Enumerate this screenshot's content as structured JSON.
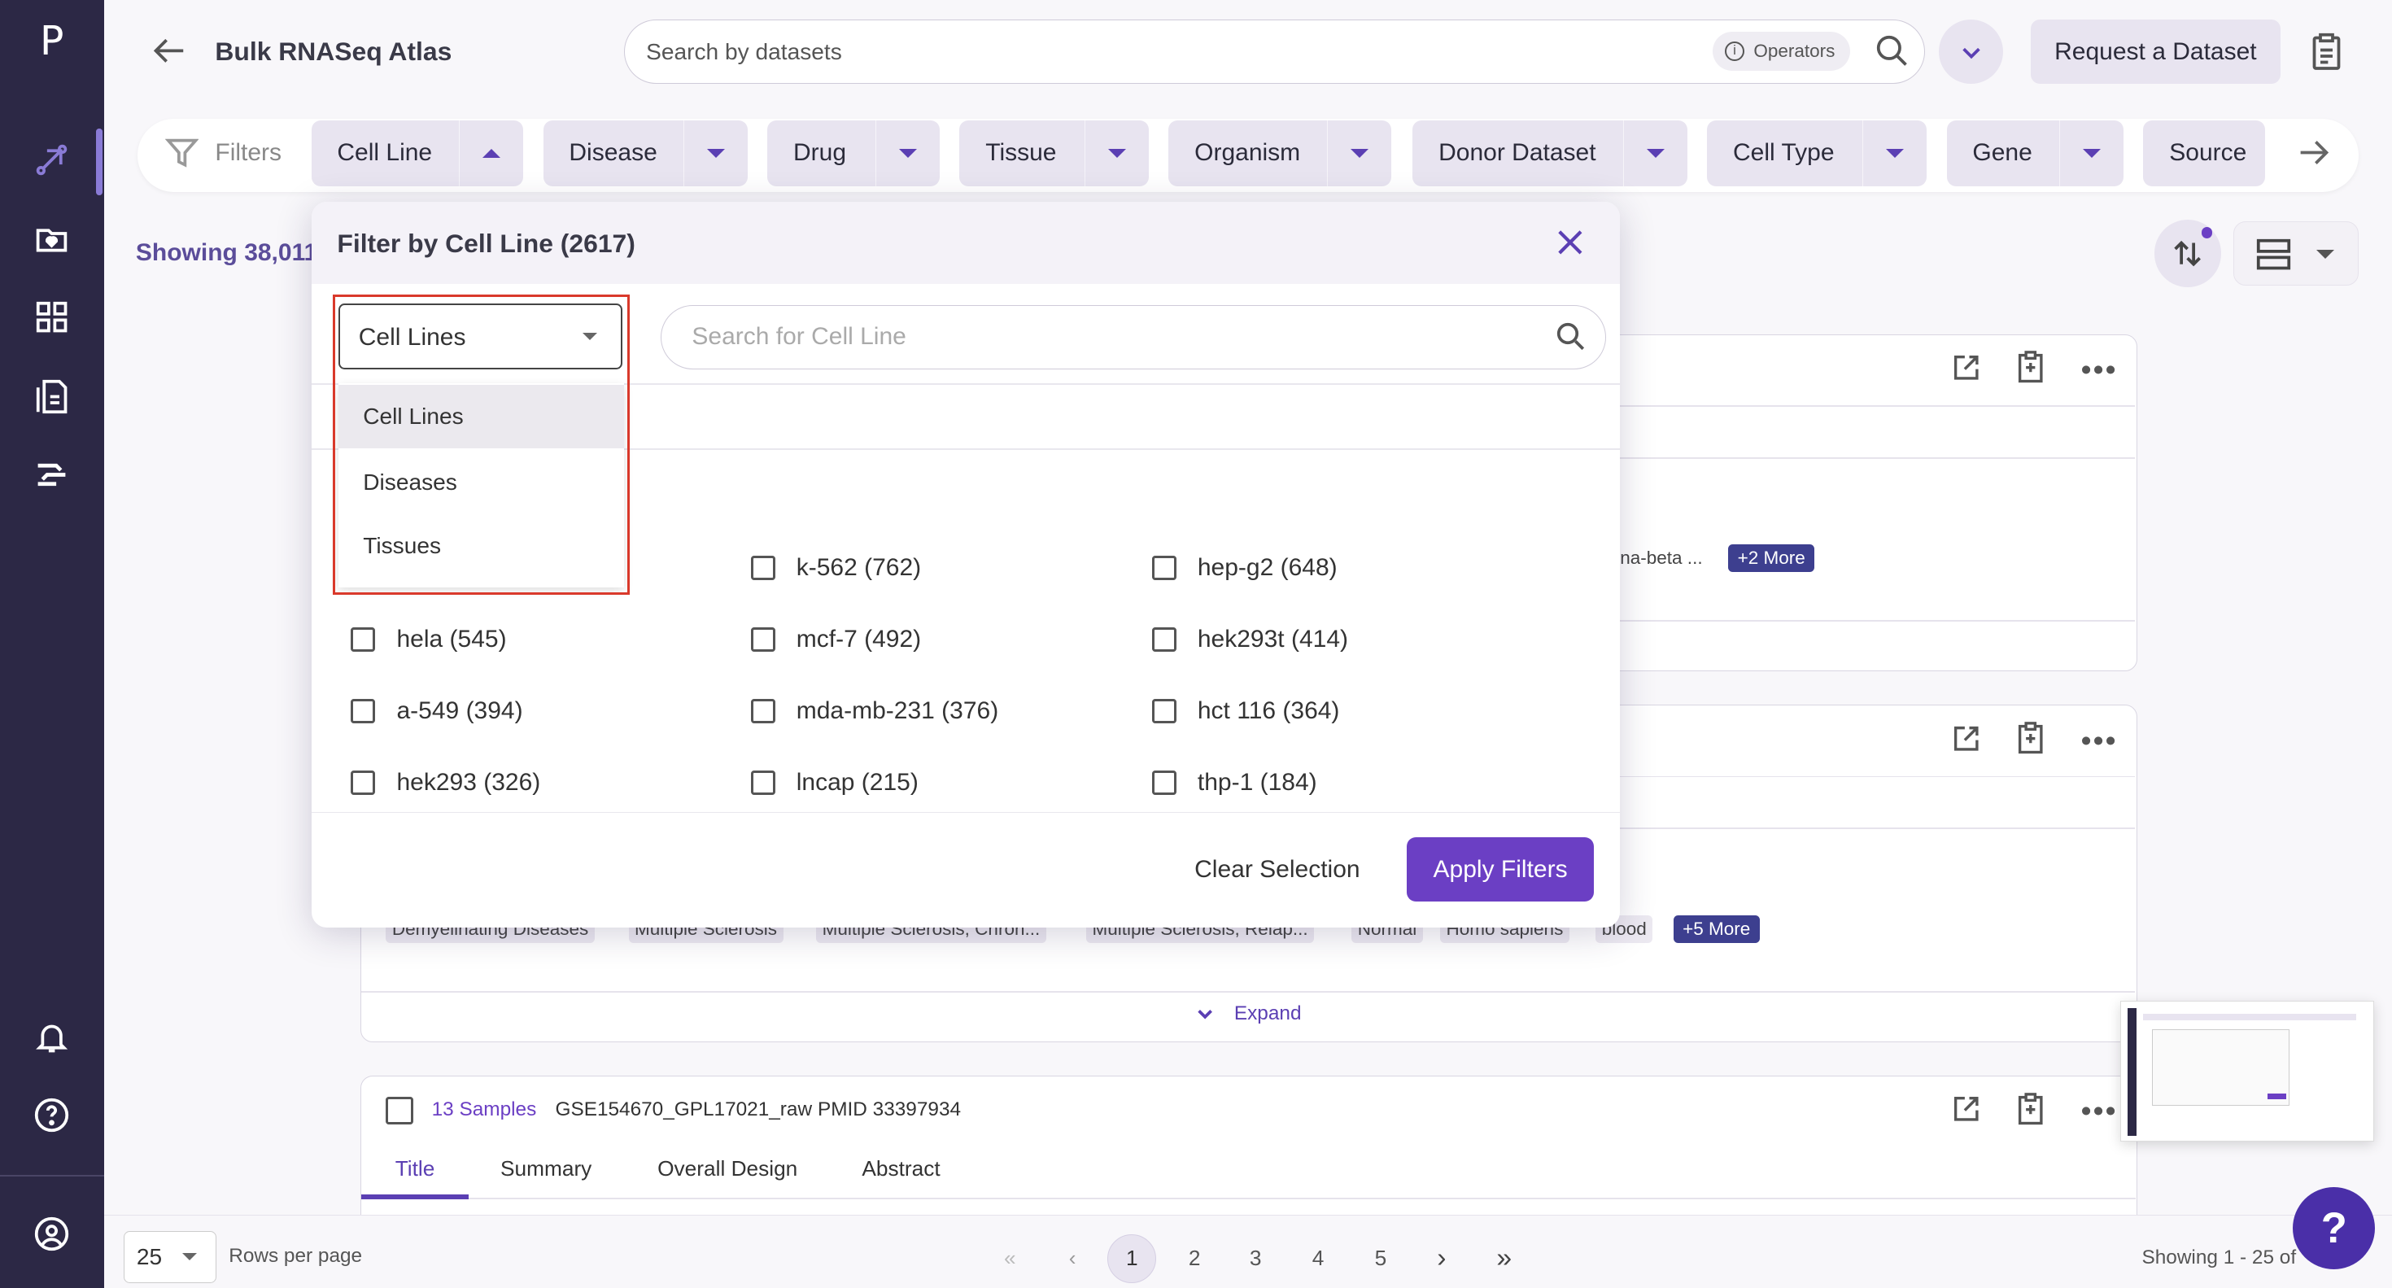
{
  "app": {
    "logo": "P",
    "title": "Bulk RNASeq Atlas"
  },
  "search": {
    "placeholder": "Search by datasets",
    "operators_label": "Operators"
  },
  "header": {
    "request_button": "Request a Dataset"
  },
  "filters": {
    "label": "Filters",
    "chips": [
      "Cell Line",
      "Disease",
      "Drug",
      "Tissue",
      "Organism",
      "Donor Dataset",
      "Cell Type",
      "Gene",
      "Source"
    ]
  },
  "results": {
    "showing_text": "Showing 38,011"
  },
  "modal": {
    "title": "Filter by Cell Line (2617)",
    "category_select": "Cell Lines",
    "category_options": [
      "Cell Lines",
      "Diseases",
      "Tissues"
    ],
    "search_placeholder": "Search for Cell Line",
    "options": [
      "k-562 (762)",
      "hep-g2 (648)",
      "hela (545)",
      "mcf-7 (492)",
      "hek293t (414)",
      "a-549 (394)",
      "mda-mb-231 (376)",
      "hct 116 (364)",
      "hek293 (326)",
      "lncap (215)",
      "thp-1 (184)"
    ],
    "clear_label": "Clear Selection",
    "apply_label": "Apply Filters"
  },
  "card1": {
    "tag_partial": "na-beta ...",
    "more": "+2 More"
  },
  "card2": {
    "tags": [
      "Demyelinating Diseases",
      "Multiple Sclerosis",
      "Multiple Sclerosis, Chron...",
      "Multiple Sclerosis, Relap...",
      "Normal",
      "Homo sapiens",
      "blood"
    ],
    "more": "+5 More",
    "expand": "Expand"
  },
  "card3": {
    "samples": "13 Samples",
    "dataset_id": "GSE154670_GPL17021_raw",
    "pmid": "PMID 33397934",
    "tabs": [
      "Title",
      "Summary",
      "Overall Design",
      "Abstract"
    ]
  },
  "pagination": {
    "rows_value": "25",
    "rows_label": "Rows per page",
    "pages": [
      "1",
      "2",
      "3",
      "4",
      "5"
    ],
    "showing": "Showing 1 - 25 of"
  },
  "help": {
    "label": "?"
  },
  "colors": {
    "accent": "#6b3fc4",
    "sidebar": "#2c2845",
    "chip": "#e8e4f0",
    "highlight_box": "#d9392b"
  }
}
